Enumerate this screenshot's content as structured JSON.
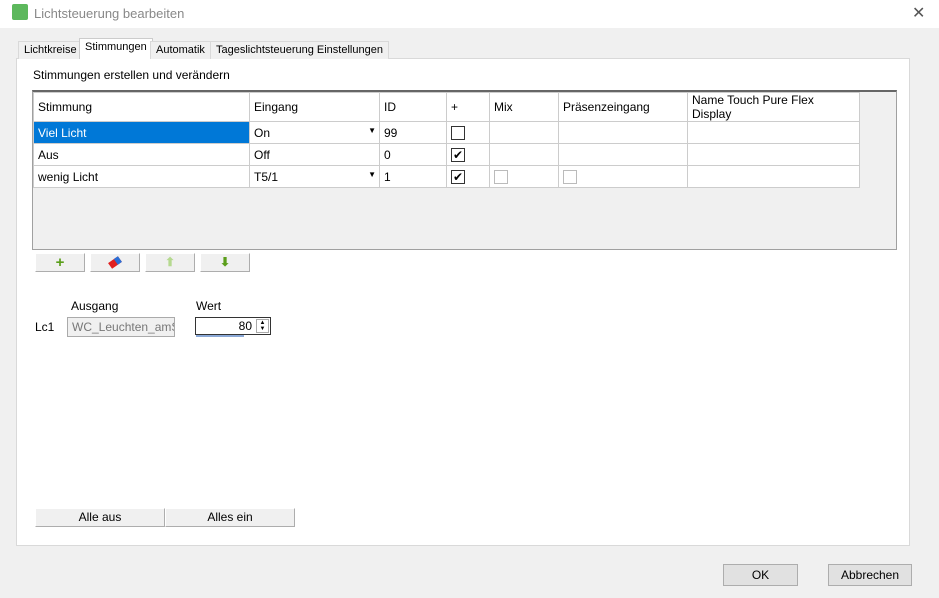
{
  "window": {
    "title": "Lichtsteuerung bearbeiten"
  },
  "tabs": [
    "Lichtkreise",
    "Stimmungen",
    "Automatik",
    "Tageslichtsteuerung Einstellungen"
  ],
  "section_title": "Stimmungen erstellen und verändern",
  "table": {
    "headers": [
      "Stimmung",
      "Eingang",
      "ID",
      "+",
      "Mix",
      "Präsenzeingang",
      "Name Touch Pure Flex Display"
    ],
    "rows": [
      {
        "stimmung": "Viel Licht",
        "eingang": "On",
        "id": "99",
        "plus": false,
        "mix": null,
        "praesenz": null
      },
      {
        "stimmung": "Aus",
        "eingang": "Off",
        "id": "0",
        "plus": true,
        "mix": null,
        "praesenz": null
      },
      {
        "stimmung": "wenig Licht",
        "eingang": "T5/1",
        "id": "1",
        "plus": true,
        "mix": false,
        "praesenz": false
      }
    ]
  },
  "output": {
    "ausgang_label": "Ausgang",
    "wert_label": "Wert",
    "row_label": "Lc1",
    "ausgang_value": "WC_Leuchten_amS|",
    "wert_value": "80",
    "wert_fraction": 0.8
  },
  "buttons": {
    "alle_aus": "Alle aus",
    "alle_ein": "Alles ein",
    "ok": "OK",
    "cancel": "Abbrechen"
  }
}
